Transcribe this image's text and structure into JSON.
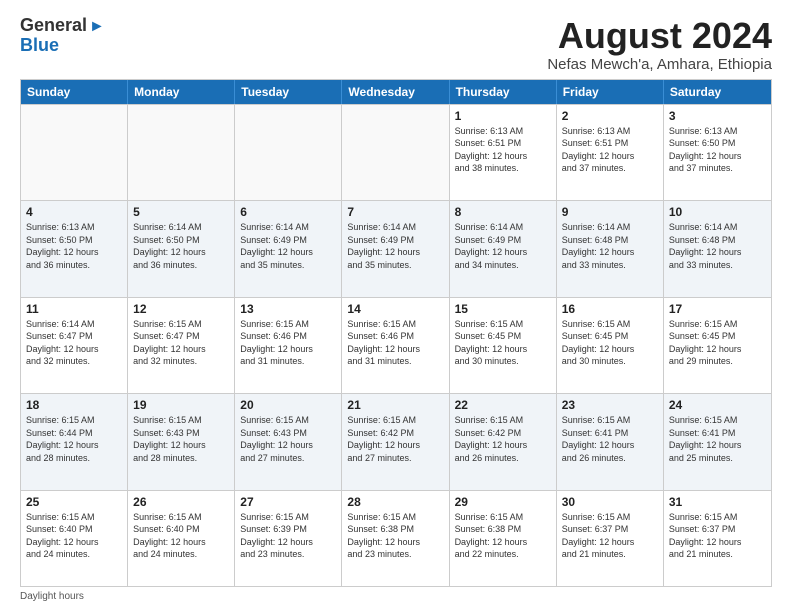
{
  "logo": {
    "general": "General",
    "blue": "Blue"
  },
  "title": "August 2024",
  "location": "Nefas Mewch'a, Amhara, Ethiopia",
  "days": [
    "Sunday",
    "Monday",
    "Tuesday",
    "Wednesday",
    "Thursday",
    "Friday",
    "Saturday"
  ],
  "footer": "Daylight hours",
  "weeks": [
    [
      {
        "date": "",
        "info": ""
      },
      {
        "date": "",
        "info": ""
      },
      {
        "date": "",
        "info": ""
      },
      {
        "date": "",
        "info": ""
      },
      {
        "date": "1",
        "info": "Sunrise: 6:13 AM\nSunset: 6:51 PM\nDaylight: 12 hours\nand 38 minutes."
      },
      {
        "date": "2",
        "info": "Sunrise: 6:13 AM\nSunset: 6:51 PM\nDaylight: 12 hours\nand 37 minutes."
      },
      {
        "date": "3",
        "info": "Sunrise: 6:13 AM\nSunset: 6:50 PM\nDaylight: 12 hours\nand 37 minutes."
      }
    ],
    [
      {
        "date": "4",
        "info": "Sunrise: 6:13 AM\nSunset: 6:50 PM\nDaylight: 12 hours\nand 36 minutes."
      },
      {
        "date": "5",
        "info": "Sunrise: 6:14 AM\nSunset: 6:50 PM\nDaylight: 12 hours\nand 36 minutes."
      },
      {
        "date": "6",
        "info": "Sunrise: 6:14 AM\nSunset: 6:49 PM\nDaylight: 12 hours\nand 35 minutes."
      },
      {
        "date": "7",
        "info": "Sunrise: 6:14 AM\nSunset: 6:49 PM\nDaylight: 12 hours\nand 35 minutes."
      },
      {
        "date": "8",
        "info": "Sunrise: 6:14 AM\nSunset: 6:49 PM\nDaylight: 12 hours\nand 34 minutes."
      },
      {
        "date": "9",
        "info": "Sunrise: 6:14 AM\nSunset: 6:48 PM\nDaylight: 12 hours\nand 33 minutes."
      },
      {
        "date": "10",
        "info": "Sunrise: 6:14 AM\nSunset: 6:48 PM\nDaylight: 12 hours\nand 33 minutes."
      }
    ],
    [
      {
        "date": "11",
        "info": "Sunrise: 6:14 AM\nSunset: 6:47 PM\nDaylight: 12 hours\nand 32 minutes."
      },
      {
        "date": "12",
        "info": "Sunrise: 6:15 AM\nSunset: 6:47 PM\nDaylight: 12 hours\nand 32 minutes."
      },
      {
        "date": "13",
        "info": "Sunrise: 6:15 AM\nSunset: 6:46 PM\nDaylight: 12 hours\nand 31 minutes."
      },
      {
        "date": "14",
        "info": "Sunrise: 6:15 AM\nSunset: 6:46 PM\nDaylight: 12 hours\nand 31 minutes."
      },
      {
        "date": "15",
        "info": "Sunrise: 6:15 AM\nSunset: 6:45 PM\nDaylight: 12 hours\nand 30 minutes."
      },
      {
        "date": "16",
        "info": "Sunrise: 6:15 AM\nSunset: 6:45 PM\nDaylight: 12 hours\nand 30 minutes."
      },
      {
        "date": "17",
        "info": "Sunrise: 6:15 AM\nSunset: 6:45 PM\nDaylight: 12 hours\nand 29 minutes."
      }
    ],
    [
      {
        "date": "18",
        "info": "Sunrise: 6:15 AM\nSunset: 6:44 PM\nDaylight: 12 hours\nand 28 minutes."
      },
      {
        "date": "19",
        "info": "Sunrise: 6:15 AM\nSunset: 6:43 PM\nDaylight: 12 hours\nand 28 minutes."
      },
      {
        "date": "20",
        "info": "Sunrise: 6:15 AM\nSunset: 6:43 PM\nDaylight: 12 hours\nand 27 minutes."
      },
      {
        "date": "21",
        "info": "Sunrise: 6:15 AM\nSunset: 6:42 PM\nDaylight: 12 hours\nand 27 minutes."
      },
      {
        "date": "22",
        "info": "Sunrise: 6:15 AM\nSunset: 6:42 PM\nDaylight: 12 hours\nand 26 minutes."
      },
      {
        "date": "23",
        "info": "Sunrise: 6:15 AM\nSunset: 6:41 PM\nDaylight: 12 hours\nand 26 minutes."
      },
      {
        "date": "24",
        "info": "Sunrise: 6:15 AM\nSunset: 6:41 PM\nDaylight: 12 hours\nand 25 minutes."
      }
    ],
    [
      {
        "date": "25",
        "info": "Sunrise: 6:15 AM\nSunset: 6:40 PM\nDaylight: 12 hours\nand 24 minutes."
      },
      {
        "date": "26",
        "info": "Sunrise: 6:15 AM\nSunset: 6:40 PM\nDaylight: 12 hours\nand 24 minutes."
      },
      {
        "date": "27",
        "info": "Sunrise: 6:15 AM\nSunset: 6:39 PM\nDaylight: 12 hours\nand 23 minutes."
      },
      {
        "date": "28",
        "info": "Sunrise: 6:15 AM\nSunset: 6:38 PM\nDaylight: 12 hours\nand 23 minutes."
      },
      {
        "date": "29",
        "info": "Sunrise: 6:15 AM\nSunset: 6:38 PM\nDaylight: 12 hours\nand 22 minutes."
      },
      {
        "date": "30",
        "info": "Sunrise: 6:15 AM\nSunset: 6:37 PM\nDaylight: 12 hours\nand 21 minutes."
      },
      {
        "date": "31",
        "info": "Sunrise: 6:15 AM\nSunset: 6:37 PM\nDaylight: 12 hours\nand 21 minutes."
      }
    ]
  ]
}
